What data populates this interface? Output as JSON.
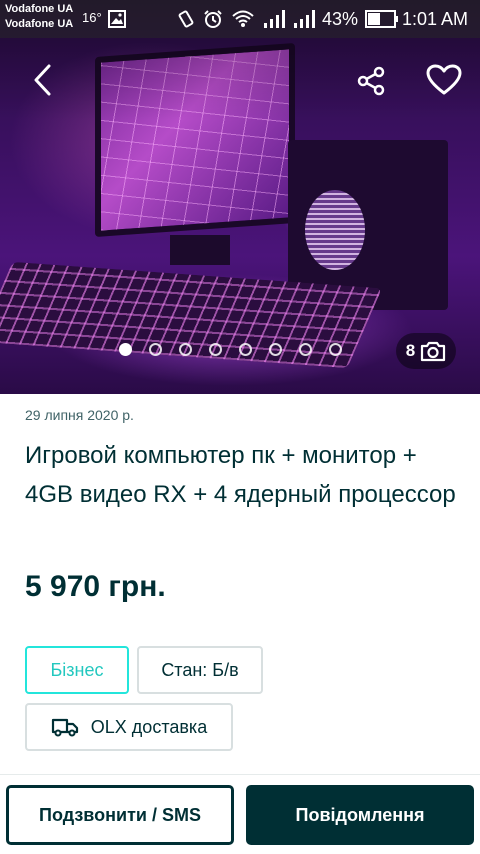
{
  "status_bar": {
    "carrier_1": "Vodafone UA",
    "carrier_2": "Vodafone UA",
    "temperature": "16°",
    "battery_percent": "43%",
    "time": "1:01 AM"
  },
  "gallery": {
    "dots_count": 8,
    "active_dot": 0,
    "photo_count": "8"
  },
  "listing": {
    "date": "29 липня 2020 р.",
    "title": "Игровой компьютер пк + монитор + 4GB видео RX + 4 ядерный процессор",
    "price": "5 970 грн.",
    "tags": {
      "business": "Бізнес",
      "condition": "Стан: Б/в",
      "delivery": "OLX доставка"
    }
  },
  "actions": {
    "call_label": "Подзвонити / SMS",
    "message_label": "Повідомлення"
  },
  "colors": {
    "primary": "#002f34",
    "accent": "#23e5db"
  }
}
